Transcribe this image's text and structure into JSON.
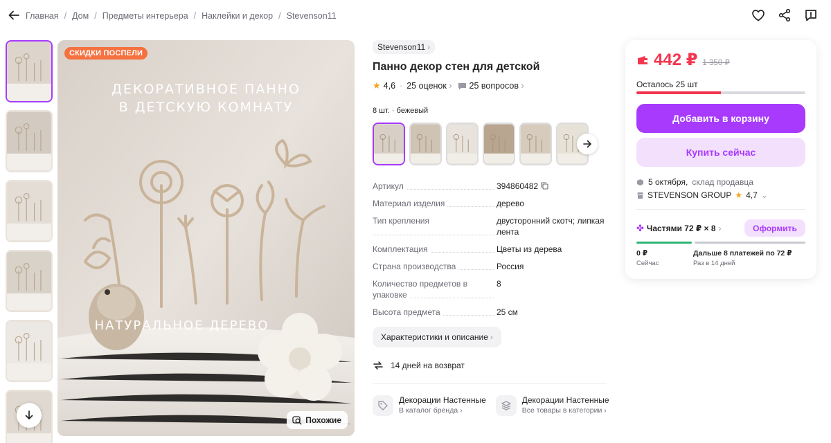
{
  "breadcrumbs": [
    "Главная",
    "Дом",
    "Предметы интерьера",
    "Наклейки и декор",
    "Stevenson11"
  ],
  "header_icons": [
    "heart-icon",
    "share-icon",
    "report-icon"
  ],
  "gallery": {
    "promo_label": "СКИДКИ ПОСПЕЛИ",
    "overlay_top": "ДЕКОРАТИВНОЕ ПАННО\nВ ДЕТСКУЮ КОМНАТУ",
    "overlay_bottom": "НАТУРАЛЬНОЕ ДЕРЕВО",
    "similar_label": "Похожие",
    "thumb_count": 6
  },
  "product": {
    "brand": "Stevenson11",
    "title": "Панно декор стен для детской",
    "rating": "4,6",
    "reviews": "25 оценок",
    "questions": "25 вопросов",
    "variant": "8 шт. · бежевый",
    "swatch_count": 6,
    "specs": [
      {
        "key": "Артикул",
        "value": "394860482"
      },
      {
        "key": "Материал изделия",
        "value": "дерево"
      },
      {
        "key": "Тип крепления",
        "value": "двусторонний скотч; липкая лента"
      },
      {
        "key": "Комплектация",
        "value": "Цветы из дерева"
      },
      {
        "key": "Страна производства",
        "value": "Россия"
      },
      {
        "key": "Количество предметов в упаковке",
        "value": "8"
      },
      {
        "key": "Высота предмета",
        "value": "25 см"
      }
    ],
    "chars_button": "Характеристики и описание",
    "return_policy": "14 дней на возврат",
    "categories": [
      {
        "title": "Декорации Настенные",
        "subtitle": "В каталог бренда"
      },
      {
        "title": "Декорации Настенные",
        "subtitle": "Все товары в категории"
      }
    ]
  },
  "purchase": {
    "price": "442 ₽",
    "old_price": "1 350 ₽",
    "stock_left": "Осталось 25 шт",
    "stock_fill_fraction": 0.5,
    "add_to_cart": "Добавить в корзину",
    "buy_now": "Купить сейчас",
    "delivery_date": "5 октября,",
    "delivery_from": "склад продавца",
    "seller_name": "STEVENSON GROUP",
    "seller_rating": "4,7",
    "installment_label": "Частями 72 ₽ × 8",
    "installment_button": "Оформить",
    "pay_now_amount": "0 ₽",
    "pay_now_label": "Сейчас",
    "pay_later_amount": "Дальше 8 платежей по 72 ₽",
    "pay_later_label": "Раз в 14 дней"
  },
  "colors": {
    "accent": "#a73afd",
    "accent_light": "#f3e0fd",
    "price_red": "#f3364f",
    "promo_orange": "#f5713f",
    "installment_green": "#2bb673"
  }
}
